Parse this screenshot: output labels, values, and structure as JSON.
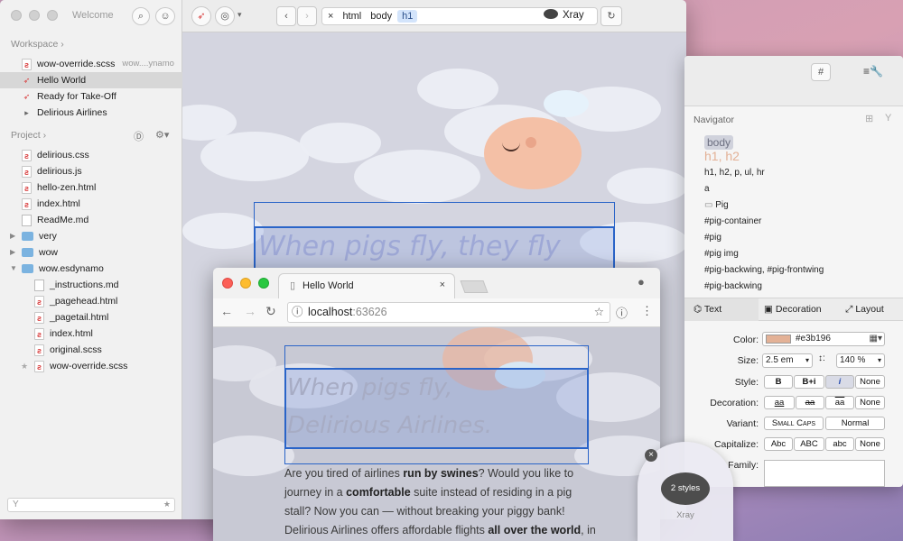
{
  "sidebar": {
    "title": "Welcome",
    "workspace_title": "Workspace",
    "workspace_items": [
      {
        "label": "wow-override.scss",
        "detail": "wow....ynamo"
      },
      {
        "label": "Hello World"
      },
      {
        "label": "Ready for Take-Off"
      },
      {
        "label": "Delirious Airlines"
      }
    ],
    "project_title": "Project",
    "project_items": [
      {
        "label": "delirious.css"
      },
      {
        "label": "delirious.js"
      },
      {
        "label": "hello-zen.html"
      },
      {
        "label": "index.html"
      },
      {
        "label": "ReadMe.md"
      },
      {
        "label": "very"
      },
      {
        "label": "wow"
      },
      {
        "label": "wow.esdynamo"
      },
      {
        "label": "_instructions.md"
      },
      {
        "label": "_pagehead.html"
      },
      {
        "label": "_pagetail.html"
      },
      {
        "label": "index.html"
      },
      {
        "label": "original.scss"
      },
      {
        "label": "wow-override.scss"
      }
    ]
  },
  "toolbar": {
    "breadcrumbs": [
      "html",
      "body",
      "h1"
    ],
    "xray_label": "Xray"
  },
  "canvas": {
    "headline": "When pigs fly, they fly"
  },
  "right_panel": {
    "hash": "#",
    "navigator_title": "Navigator",
    "nav_items": [
      "body",
      "h1, h2",
      "h1, h2, p, ul, hr",
      "a",
      "Pig",
      "#pig-container",
      "#pig",
      "#pig img",
      "#pig-backwing, #pig-frontwing",
      "#pig-backwing"
    ],
    "tabs": [
      "Text",
      "Decoration",
      "Layout"
    ],
    "color_label": "Color:",
    "color_value": "#e3b196",
    "color_swatch": "#e3b196",
    "size_label": "Size:",
    "size_value": "2.5 em",
    "line_height_value": "140 %",
    "style_label": "Style:",
    "style_options": [
      "B",
      "B+i",
      "i",
      "None"
    ],
    "decoration_label": "Decoration:",
    "decoration_options": [
      "aa",
      "aa",
      "aa",
      "None"
    ],
    "variant_label": "Variant:",
    "variant_options": [
      "Small Caps",
      "Normal"
    ],
    "capitalize_label": "Capitalize:",
    "capitalize_options": [
      "Abc",
      "ABC",
      "abc",
      "None"
    ],
    "family_label": "Family:"
  },
  "browser": {
    "tab_title": "Hello World",
    "url_host": "localhost",
    "url_port": ":63626",
    "headline_line1": "When pigs fly,",
    "headline_line2": "Delirious Airlines.",
    "para_lines": [
      [
        "Are you tired of airlines ",
        "run by swines",
        "? Would you like to"
      ],
      [
        "journey in a ",
        "comfortable",
        " suite instead of residing in a pig"
      ],
      [
        "stall? Now you can — without breaking your piggy bank!",
        ""
      ],
      [
        "Delirious Airlines offers affordable flights ",
        "all over the world",
        ", in"
      ]
    ]
  },
  "xray_bubble": {
    "styles_label": "2 styles",
    "name": "Xray"
  }
}
